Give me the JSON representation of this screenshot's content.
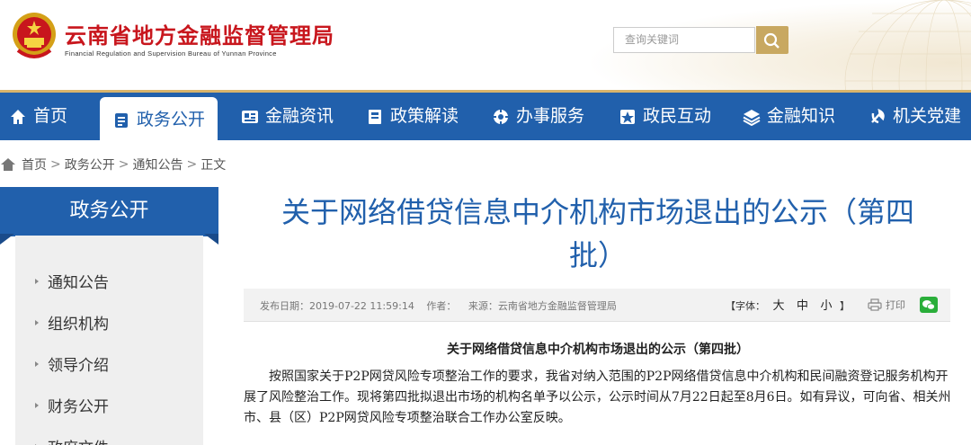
{
  "header": {
    "title": "云南省地方金融监督管理局",
    "subtitle": "Financial Regulation and Supervision Bureau of Yunnan Province",
    "search_placeholder": "查询关键词",
    "brand_color": "#c8161d",
    "accent_color": "#c8a861"
  },
  "nav": {
    "color": "#2160ac",
    "items": [
      {
        "label": "首页",
        "icon": "home-icon"
      },
      {
        "label": "政务公开",
        "icon": "document-icon",
        "active": true
      },
      {
        "label": "金融资讯",
        "icon": "info-icon"
      },
      {
        "label": "政策解读",
        "icon": "book-icon"
      },
      {
        "label": "办事服务",
        "icon": "service-icon"
      },
      {
        "label": "政民互动",
        "icon": "interaction-icon"
      },
      {
        "label": "金融知识",
        "icon": "layers-icon"
      },
      {
        "label": "机关党建",
        "icon": "party-icon"
      }
    ]
  },
  "breadcrumb": [
    "首页",
    "政务公开",
    "通知公告",
    "正文"
  ],
  "sidebar": {
    "title": "政务公开",
    "items": [
      {
        "label": "通知公告"
      },
      {
        "label": "组织机构"
      },
      {
        "label": "领导介绍"
      },
      {
        "label": "财务公开"
      },
      {
        "label": "政府文件"
      }
    ]
  },
  "article": {
    "title_line1": "关于网络借贷信息中介机构市场退出的公示（第四",
    "title_line2": "批）",
    "meta": {
      "publish_label": "发布日期：",
      "publish_date": "2019-07-22 11:59:14",
      "author_label": "作者：",
      "source_label": "来源：",
      "source": "云南省地方金融监督管理局",
      "font_label": "【字体：",
      "font_large": "大",
      "font_medium": "中",
      "font_small": "小",
      "font_end": "】",
      "print_label": "打印"
    },
    "subtitle": "关于网络借贷信息中介机构市场退出的公示（第四批）",
    "body": "按照国家关于P2P网贷风险专项整治工作的要求，我省对纳入范围的P2P网络借贷信息中介机构和民间融资登记服务机构开展了风险整治工作。现将第四批拟退出市场的机构名单予以公示，公示时间从7月22日起至8月6日。如有异议，可向省、相关州市、县（区）P2P网贷风险专项整治联合工作办公室反映。"
  }
}
